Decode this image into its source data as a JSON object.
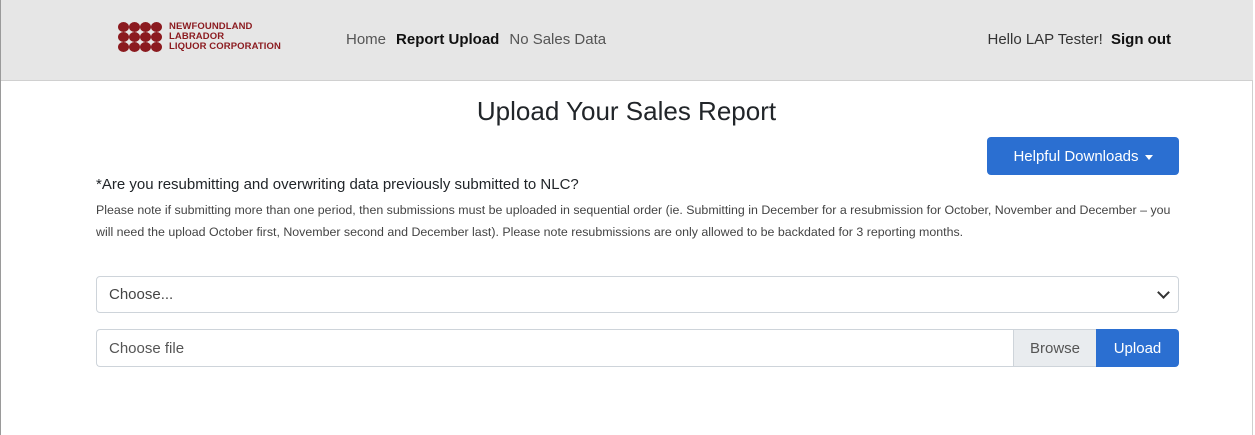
{
  "brand": {
    "line1": "NEWFOUNDLAND",
    "line2": "LABRADOR",
    "line3": "LIQUOR CORPORATION",
    "color": "#8b1a1f"
  },
  "nav": {
    "home": "Home",
    "report_upload": "Report Upload",
    "no_sales_data": "No Sales Data"
  },
  "user": {
    "greeting": "Hello LAP Tester!",
    "sign_out": "Sign out"
  },
  "main": {
    "title": "Upload Your Sales Report",
    "downloads_button": "Helpful Downloads",
    "question": "*Are you resubmitting and overwriting data previously submitted to NLC?",
    "note": "Please note if submitting more than one period, then submissions must be uploaded in sequential order (ie. Submitting in December for a resubmission for October, November and December – you will need the upload October first, November second and December last). Please note resubmissions are only allowed to be backdated for 3 reporting months.",
    "select_value": "Choose...",
    "file_placeholder": "Choose file",
    "browse_label": "Browse",
    "upload_label": "Upload"
  },
  "colors": {
    "accent": "#2b6fd1",
    "navbar_bg": "#e6e6e6"
  },
  "icons": {
    "logo": "nlc-dots-logo",
    "dropdown_caret": "caret-down-icon",
    "select_chevron": "chevron-down-icon"
  }
}
